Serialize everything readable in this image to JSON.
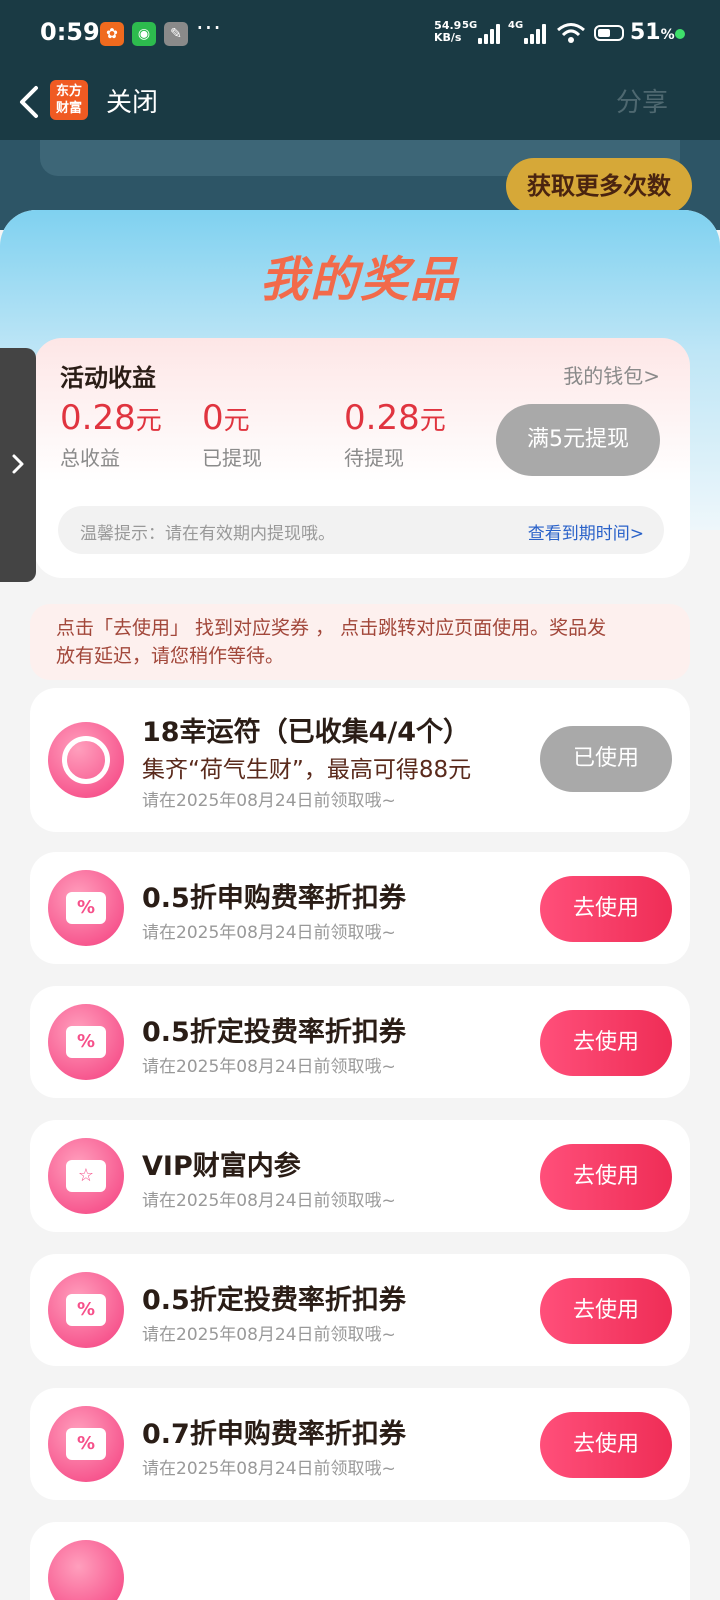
{
  "status_bar": {
    "time": "0:59",
    "net_speed_value": "54.9",
    "net_speed_unit": "KB/s",
    "signal1_label": "5G",
    "signal2_label": "4G",
    "battery_percent": "51",
    "battery_unit": "%"
  },
  "nav": {
    "logo_text_line1": "东方",
    "logo_text_line2": "财富",
    "close_label": "关闭",
    "share_label": "分享"
  },
  "background": {
    "more_tries_label": "获取更多次数"
  },
  "sheet": {
    "title": "我的奖品",
    "earnings": {
      "title": "活动收益",
      "wallet_link": "我的钱包>",
      "stats": [
        {
          "value": "0.28",
          "unit": "元",
          "label": "总收益"
        },
        {
          "value": "0",
          "unit": "元",
          "label": "已提现"
        },
        {
          "value": "0.28",
          "unit": "元",
          "label": "待提现"
        }
      ],
      "withdraw_button": "满5元提现",
      "tip": "温馨提示：请在有效期内提现哦。",
      "tip_link": "查看到期时间>"
    },
    "notice_line1": "点击「去使用」 找到对应奖券 ， 点击跳转对应页面使用。奖品发",
    "notice_line2": "放有延迟，请您稍作等待。",
    "prizes": [
      {
        "icon": "lucky-charm-icon",
        "name": "18幸运符（已收集4/4个）",
        "desc": "集齐“荷气生财”，最高可得88元",
        "expiry": "请在2025年08月24日前领取哦~",
        "button": "已使用",
        "state": "used"
      },
      {
        "icon": "percent-coupon-icon",
        "name": "0.5折申购费率折扣券",
        "desc": "",
        "expiry": "请在2025年08月24日前领取哦~",
        "button": "去使用",
        "state": "go"
      },
      {
        "icon": "percent-coupon-icon",
        "name": "0.5折定投费率折扣券",
        "desc": "",
        "expiry": "请在2025年08月24日前领取哦~",
        "button": "去使用",
        "state": "go"
      },
      {
        "icon": "star-ticket-icon",
        "name": "VIP财富内参",
        "desc": "",
        "expiry": "请在2025年08月24日前领取哦~",
        "button": "去使用",
        "state": "go"
      },
      {
        "icon": "percent-coupon-icon",
        "name": "0.5折定投费率折扣券",
        "desc": "",
        "expiry": "请在2025年08月24日前领取哦~",
        "button": "去使用",
        "state": "go"
      },
      {
        "icon": "percent-coupon-icon",
        "name": "0.7折申购费率折扣券",
        "desc": "",
        "expiry": "请在2025年08月24日前领取哦~",
        "button": "去使用",
        "state": "go"
      }
    ]
  },
  "colors": {
    "header_bg": "#1a3a44",
    "accent_red": "#e0343f",
    "button_pink": "#ef2d56",
    "disabled_gray": "#a9a9a9"
  }
}
